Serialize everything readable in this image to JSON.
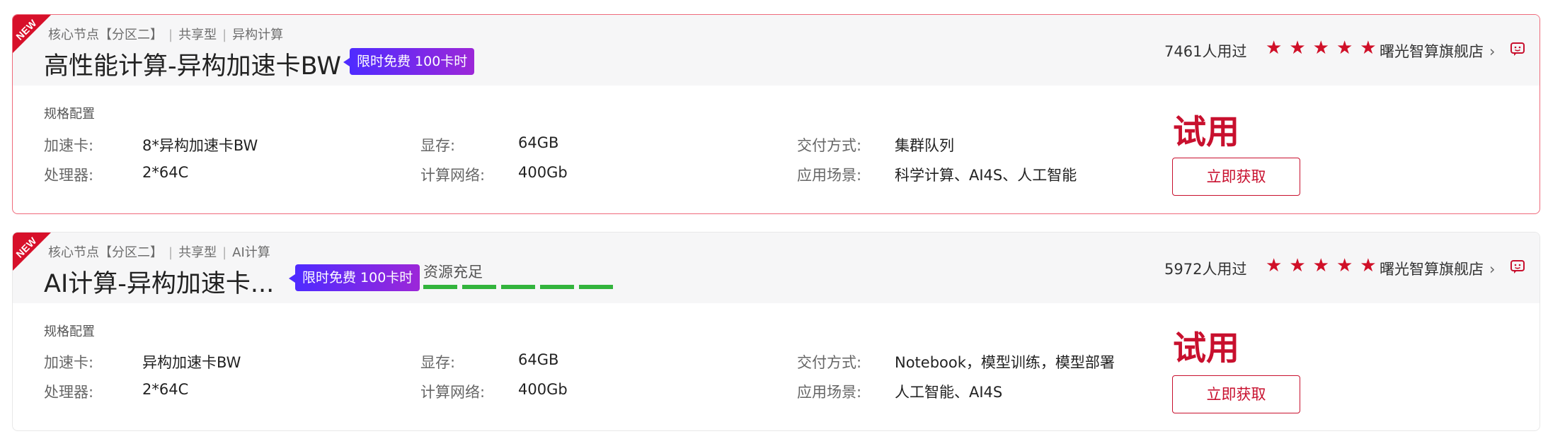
{
  "colors": {
    "accent": "#c8102e",
    "ribbon": "#d7102a",
    "availability": "#33b43d",
    "promo_start": "#4f2bff",
    "promo_end": "#9c27d8"
  },
  "products": [
    {
      "ribbon": "NEW",
      "crumbs": [
        "核心节点【分区二】",
        "共享型",
        "异构计算"
      ],
      "title": "高性能计算-异构加速卡BW",
      "promo": "限时免费 100卡时",
      "users": "7461人用过",
      "rating": 5,
      "shop": "曙光智算旗舰店",
      "shop_arrow": "›",
      "spec_heading": "规格配置",
      "specs": {
        "accel_label": "加速卡:",
        "accel_value": "8*异构加速卡BW",
        "cpu_label": "处理器:",
        "cpu_value": "2*64C",
        "mem_label": "显存:",
        "mem_value": "64GB",
        "net_label": "计算网络:",
        "net_value": "400Gb",
        "delivery_label": "交付方式:",
        "delivery_value": "集群队列",
        "scene_label": "应用场景:",
        "scene_value": "科学计算、AI4S、人工智能"
      },
      "trial": "试用",
      "button": "立即获取"
    },
    {
      "ribbon": "NEW",
      "crumbs": [
        "核心节点【分区二】",
        "共享型",
        "AI计算"
      ],
      "title": "AI计算-异构加速卡...",
      "promo": "限时免费 100卡时",
      "availability_label": "资源充足",
      "availability_level": 5,
      "users": "5972人用过",
      "rating": 5,
      "shop": "曙光智算旗舰店",
      "shop_arrow": "›",
      "spec_heading": "规格配置",
      "specs": {
        "accel_label": "加速卡:",
        "accel_value": "异构加速卡BW",
        "cpu_label": "处理器:",
        "cpu_value": "2*64C",
        "mem_label": "显存:",
        "mem_value": "64GB",
        "net_label": "计算网络:",
        "net_value": "400Gb",
        "delivery_label": "交付方式:",
        "delivery_value": "Notebook，模型训练，模型部署",
        "scene_label": "应用场景:",
        "scene_value": "人工智能、AI4S"
      },
      "trial": "试用",
      "button": "立即获取"
    }
  ]
}
